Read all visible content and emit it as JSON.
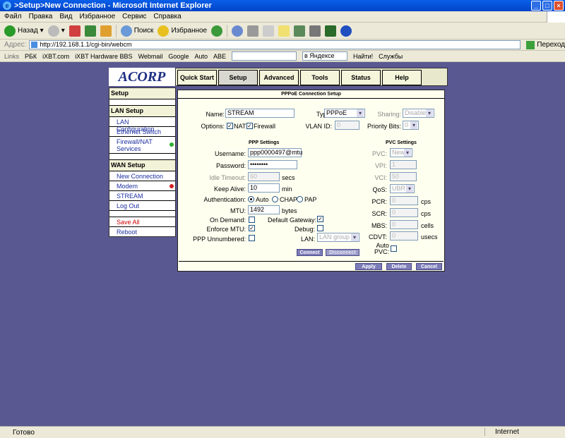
{
  "window": {
    "title": ">Setup>New Connection - Microsoft Internet Explorer",
    "menu": [
      "Файл",
      "Правка",
      "Вид",
      "Избранное",
      "Сервис",
      "Справка"
    ],
    "toolbar": {
      "back": "Назад",
      "search": "Поиск",
      "favorites": "Избранное"
    },
    "address_label": "Адрес:",
    "address": "http://192.168.1.1/cgi-bin/webcm",
    "go": "Переход",
    "links_label": "Links",
    "links": [
      "РБК",
      "iXBT.com",
      "iXBT Hardware BBS",
      "Webmail",
      "Google",
      "Auto",
      "ABE"
    ],
    "yandex_select": "в Яндексе",
    "find": "Найти!",
    "services": "Службы",
    "status": "Готово",
    "zone": "Internet"
  },
  "logo": "ACORP",
  "nav": {
    "tabs": [
      "Quick Start",
      "Setup",
      "Advanced",
      "Tools",
      "Status",
      "Help"
    ],
    "active": "Setup"
  },
  "sidebar": {
    "header": "Setup",
    "lan_header": "LAN Setup",
    "lan_items": [
      "LAN Configuration",
      "Ethernet Switch",
      "Firewall/NAT Services"
    ],
    "wan_header": "WAN Setup",
    "wan_items": [
      "New Connection",
      "Modem",
      "STREAM",
      "Log Out"
    ],
    "save_all": "Save All",
    "reboot": "Reboot",
    "status_colors": {
      "firewall": "#2db02d",
      "modem": "#d22020"
    }
  },
  "form": {
    "title": "PPPoE Connection Setup",
    "name_label": "Name:",
    "name_value": "STREAM",
    "type_label": "Type:",
    "type_value": "PPPoE",
    "sharing_label": "Sharing:",
    "sharing_value": "Disable",
    "options_label": "Options:",
    "nat_label": "NAT",
    "firewall_label": "Firewall",
    "vlan_label": "VLAN ID:",
    "vlan_value": "0",
    "priority_label": "Priority Bits:",
    "priority_value": "0",
    "ppp_title": "PPP Settings",
    "pvc_title": "PVC Settings",
    "username_label": "Username:",
    "username_value": "ppp0000497@mtu",
    "password_label": "Password:",
    "password_value": "••••••••",
    "idle_label": "Idle Timeout:",
    "idle_value": "60",
    "idle_unit": "secs",
    "keepalive_label": "Keep Alive:",
    "keepalive_value": "10",
    "keepalive_unit": "min",
    "auth_label": "Authentication:",
    "auth_auto": "Auto",
    "auth_chap": "CHAP",
    "auth_pap": "PAP",
    "mtu_label": "MTU:",
    "mtu_value": "1492",
    "mtu_unit": "bytes",
    "ondemand_label": "On Demand:",
    "default_gw_label": "Default Gateway:",
    "enforce_mtu_label": "Enforce MTU:",
    "debug_label": "Debug:",
    "ppp_unnumbered_label": "PPP Unnumbered:",
    "lan_label": "LAN:",
    "lan_value": "LAN group 1",
    "pvc_label": "PVC:",
    "pvc_value": "New",
    "vpi_label": "VPI:",
    "vpi_value": "1",
    "vci_label": "VCI:",
    "vci_value": "50",
    "qos_label": "QoS:",
    "qos_value": "UBR",
    "pcr_label": "PCR:",
    "pcr_value": "0",
    "pcr_unit": "cps",
    "scr_label": "SCR:",
    "scr_value": "0",
    "scr_unit": "cps",
    "mbs_label": "MBS:",
    "mbs_value": "0",
    "mbs_unit": "cells",
    "cdvt_label": "CDVT:",
    "cdvt_value": "0",
    "cdvt_unit": "usecs",
    "autopvc_label": "Auto PVC:",
    "connect": "Connect",
    "disconnect": "Disconnect",
    "apply": "Apply",
    "delete": "Delete",
    "cancel": "Cancel"
  }
}
